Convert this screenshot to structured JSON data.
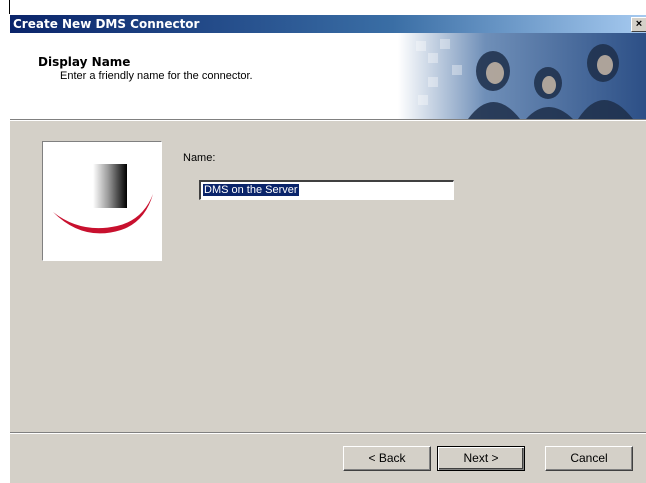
{
  "window": {
    "title": "Create New DMS Connector",
    "close_glyph": "×"
  },
  "header": {
    "title": "Display Name",
    "subtitle": "Enter a friendly name for the connector."
  },
  "form": {
    "name_label": "Name:",
    "name_value": "DMS on the Server"
  },
  "buttons": {
    "back": "< Back",
    "next": "Next >",
    "cancel": "Cancel"
  },
  "icons": {
    "wizard_image": "connector-logo-icon",
    "header_art": "people-photo-collage"
  },
  "colors": {
    "titlebar_start": "#0a246a",
    "titlebar_end": "#a6caf0",
    "dialog_bg": "#d4d0c8",
    "selection": "#0a246a",
    "logo_swoosh": "#c8102e"
  }
}
